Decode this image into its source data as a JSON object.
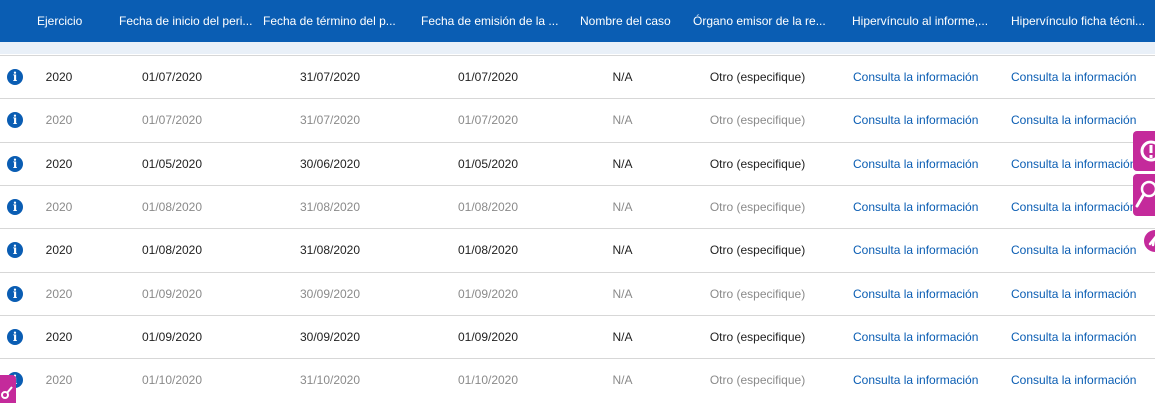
{
  "columns": [
    "Ejercicio",
    "Fecha de inicio del peri...",
    "Fecha de término del p...",
    "Fecha de emisión de la ...",
    "Nombre del caso",
    "Órgano emisor de la re...",
    "Hipervínculo al informe,...",
    "Hipervínculo ficha técni..."
  ],
  "rows": [
    {
      "ejercicio": "2020",
      "inicio": "01/07/2020",
      "termino": "31/07/2020",
      "emision": "01/07/2020",
      "caso": "N/A",
      "organo": "Otro (especifique)",
      "link1": "Consulta la información",
      "link2": "Consulta la información",
      "tone": "dark"
    },
    {
      "ejercicio": "2020",
      "inicio": "01/07/2020",
      "termino": "31/07/2020",
      "emision": "01/07/2020",
      "caso": "N/A",
      "organo": "Otro (especifique)",
      "link1": "Consulta la información",
      "link2": "Consulta la información",
      "tone": "light"
    },
    {
      "ejercicio": "2020",
      "inicio": "01/05/2020",
      "termino": "30/06/2020",
      "emision": "01/05/2020",
      "caso": "N/A",
      "organo": "Otro (especifique)",
      "link1": "Consulta la información",
      "link2": "Consulta la información",
      "tone": "dark"
    },
    {
      "ejercicio": "2020",
      "inicio": "01/08/2020",
      "termino": "31/08/2020",
      "emision": "01/08/2020",
      "caso": "N/A",
      "organo": "Otro (especifique)",
      "link1": "Consulta la información",
      "link2": "Consulta la información",
      "tone": "light"
    },
    {
      "ejercicio": "2020",
      "inicio": "01/08/2020",
      "termino": "31/08/2020",
      "emision": "01/08/2020",
      "caso": "N/A",
      "organo": "Otro (especifique)",
      "link1": "Consulta la información",
      "link2": "Consulta la información",
      "tone": "dark"
    },
    {
      "ejercicio": "2020",
      "inicio": "01/09/2020",
      "termino": "30/09/2020",
      "emision": "01/09/2020",
      "caso": "N/A",
      "organo": "Otro (especifique)",
      "link1": "Consulta la información",
      "link2": "Consulta la información",
      "tone": "light"
    },
    {
      "ejercicio": "2020",
      "inicio": "01/09/2020",
      "termino": "30/09/2020",
      "emision": "01/09/2020",
      "caso": "N/A",
      "organo": "Otro (especifique)",
      "link1": "Consulta la información",
      "link2": "Consulta la información",
      "tone": "dark"
    },
    {
      "ejercicio": "2020",
      "inicio": "01/10/2020",
      "termino": "31/10/2020",
      "emision": "01/10/2020",
      "caso": "N/A",
      "organo": "Otro (especifique)",
      "link1": "Consulta la información",
      "link2": "Consulta la información",
      "tone": "light"
    }
  ],
  "icons": {
    "row_action": "info-icon",
    "side_tab_1": "alert-icon",
    "side_tab_2": "magnifier-icon",
    "side_circle": "accessibility-icon",
    "corner_tab": "tool-icon"
  },
  "info_glyph": "i",
  "colors": {
    "header": "#0a5db3",
    "link": "#0a5db3",
    "accent": "#c42a9b"
  }
}
